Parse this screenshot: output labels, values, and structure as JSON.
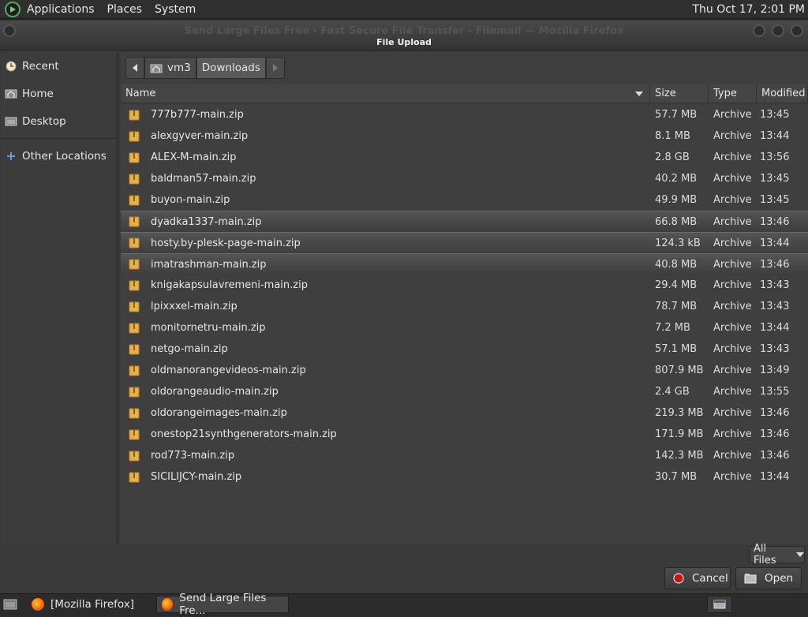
{
  "topbar": {
    "menus": [
      "Applications",
      "Places",
      "System"
    ],
    "clock": "Thu Oct 17,  2:01 PM"
  },
  "window": {
    "ghost_title": "Send Large Files Free - Fast Secure File Transfer - Filemail — Mozilla Firefox",
    "dialog_title": "File Upload"
  },
  "sidebar": {
    "items": [
      {
        "label": "Recent",
        "icon": "clock-icon"
      },
      {
        "label": "Home",
        "icon": "home-icon"
      },
      {
        "label": "Desktop",
        "icon": "desktop-icon"
      }
    ],
    "other_locations": "Other Locations"
  },
  "pathbar": {
    "segments": [
      "vm3",
      "Downloads"
    ]
  },
  "columns": {
    "name": "Name",
    "size": "Size",
    "type": "Type",
    "modified": "Modified"
  },
  "files": [
    {
      "name": "777b777-main.zip",
      "size": "57.7 MB",
      "type": "Archive",
      "modified": "13:45"
    },
    {
      "name": "alexgyver-main.zip",
      "size": "8.1 MB",
      "type": "Archive",
      "modified": "13:44"
    },
    {
      "name": "ALEX-M-main.zip",
      "size": "2.8 GB",
      "type": "Archive",
      "modified": "13:56"
    },
    {
      "name": "baldman57-main.zip",
      "size": "40.2 MB",
      "type": "Archive",
      "modified": "13:45"
    },
    {
      "name": "buyon-main.zip",
      "size": "49.9 MB",
      "type": "Archive",
      "modified": "13:45"
    },
    {
      "name": "dyadka1337-main.zip",
      "size": "66.8 MB",
      "type": "Archive",
      "modified": "13:46"
    },
    {
      "name": "hosty.by-plesk-page-main.zip",
      "size": "124.3 kB",
      "type": "Archive",
      "modified": "13:44"
    },
    {
      "name": "imatrashman-main.zip",
      "size": "40.8 MB",
      "type": "Archive",
      "modified": "13:46"
    },
    {
      "name": "knigakapsulavremeni-main.zip",
      "size": "29.4 MB",
      "type": "Archive",
      "modified": "13:43"
    },
    {
      "name": "lpixxxel-main.zip",
      "size": "78.7 MB",
      "type": "Archive",
      "modified": "13:43"
    },
    {
      "name": "monitornetru-main.zip",
      "size": "7.2 MB",
      "type": "Archive",
      "modified": "13:44"
    },
    {
      "name": "netgo-main.zip",
      "size": "57.1 MB",
      "type": "Archive",
      "modified": "13:43"
    },
    {
      "name": "oldmanorangevideos-main.zip",
      "size": "807.9 MB",
      "type": "Archive",
      "modified": "13:49"
    },
    {
      "name": "oldorangeaudio-main.zip",
      "size": "2.4 GB",
      "type": "Archive",
      "modified": "13:55"
    },
    {
      "name": "oldorangeimages-main.zip",
      "size": "219.3 MB",
      "type": "Archive",
      "modified": "13:46"
    },
    {
      "name": "onestop21synthgenerators-main.zip",
      "size": "171.9 MB",
      "type": "Archive",
      "modified": "13:46"
    },
    {
      "name": "rod773-main.zip",
      "size": "142.3 MB",
      "type": "Archive",
      "modified": "13:46"
    },
    {
      "name": "SICILIJCY-main.zip",
      "size": "30.7 MB",
      "type": "Archive",
      "modified": "13:44"
    }
  ],
  "highlighted_rows": [
    5,
    6,
    7
  ],
  "filter": {
    "label": "All Files"
  },
  "buttons": {
    "cancel": "Cancel",
    "open": "Open"
  },
  "taskbar": {
    "tasks": [
      "[Mozilla Firefox]",
      "Send Large Files Fre..."
    ]
  },
  "colors": {
    "accent_cancel": "#cc1111",
    "folder": "#e8b04a"
  }
}
